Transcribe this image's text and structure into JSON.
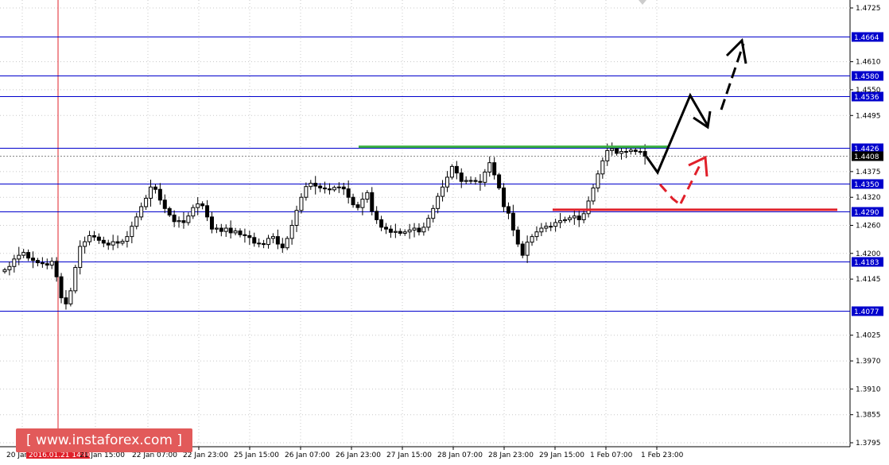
{
  "chart_data": {
    "type": "candlestick",
    "x_axis_labels": [
      "20 Jan 2016",
      "2016.01.21 14:00",
      "21 Jan 15:00",
      "22 Jan 07:00",
      "22 Jan 23:00",
      "25 Jan 15:00",
      "26 Jan 07:00",
      "26 Jan 23:00",
      "27 Jan 15:00",
      "28 Jan 07:00",
      "28 Jan 23:00",
      "29 Jan 15:00",
      "1 Feb 07:00",
      "1 Feb 23:00"
    ],
    "y_axis_ticks": [
      "1.4725",
      "1.4610",
      "1.4550",
      "1.4495",
      "1.4375",
      "1.4320",
      "1.4260",
      "1.4200",
      "1.4145",
      "1.4025",
      "1.3970",
      "1.3910",
      "1.3855",
      "1.3795"
    ],
    "ylim": [
      1.3795,
      1.4725
    ],
    "current_price": "1.4408",
    "levels": [
      {
        "price": 1.4664,
        "label": "1.4664"
      },
      {
        "price": 1.458,
        "label": "1.4580"
      },
      {
        "price": 1.4536,
        "label": "1.4536"
      },
      {
        "price": 1.4426,
        "label": "1.4426"
      },
      {
        "price": 1.435,
        "label": "1.4350"
      },
      {
        "price": 1.429,
        "label": "1.4290"
      },
      {
        "price": 1.4183,
        "label": "1.4183"
      },
      {
        "price": 1.4077,
        "label": "1.4077"
      }
    ],
    "resistance_line": {
      "price": 1.4428,
      "color": "#3cb043"
    },
    "support_line": {
      "price": 1.429,
      "color": "#e0202a"
    },
    "vertical_marker": {
      "label": "2016.01.21 14:00",
      "color": "#e0202a"
    },
    "close_prices": [
      1.4165,
      1.4172,
      1.4188,
      1.4196,
      1.4202,
      1.419,
      1.4185,
      1.418,
      1.4178,
      1.4175,
      1.4183,
      1.415,
      1.4105,
      1.4092,
      1.412,
      1.417,
      1.4215,
      1.4225,
      1.4238,
      1.4235,
      1.4228,
      1.4222,
      1.4218,
      1.4225,
      1.4222,
      1.4226,
      1.4236,
      1.4258,
      1.4278,
      1.43,
      1.4318,
      1.4342,
      1.4337,
      1.4314,
      1.4296,
      1.4282,
      1.4268,
      1.427,
      1.4266,
      1.428,
      1.4298,
      1.4306,
      1.4302,
      1.4278,
      1.4252,
      1.4254,
      1.4247,
      1.4254,
      1.4244,
      1.4248,
      1.424,
      1.4238,
      1.4234,
      1.4222,
      1.4221,
      1.4219,
      1.4232,
      1.4236,
      1.422,
      1.4212,
      1.4232,
      1.426,
      1.4292,
      1.432,
      1.4343,
      1.435,
      1.4344,
      1.434,
      1.4338,
      1.4336,
      1.4341,
      1.4342,
      1.4338,
      1.432,
      1.4304,
      1.4298,
      1.4316,
      1.433,
      1.429,
      1.4272,
      1.4256,
      1.4252,
      1.4245,
      1.4247,
      1.4243,
      1.4246,
      1.425,
      1.4254,
      1.4246,
      1.4256,
      1.4275,
      1.4296,
      1.4322,
      1.4342,
      1.4363,
      1.4386,
      1.4372,
      1.4354,
      1.4356,
      1.4356,
      1.4354,
      1.4352,
      1.4374,
      1.4394,
      1.4368,
      1.434,
      1.43,
      1.4286,
      1.425,
      1.422,
      1.4196,
      1.4224,
      1.4236,
      1.4246,
      1.4254,
      1.4258,
      1.4258,
      1.4266,
      1.427,
      1.4272,
      1.4276,
      1.428,
      1.4272,
      1.4285,
      1.4312,
      1.434,
      1.437,
      1.4398,
      1.442,
      1.4424,
      1.4414,
      1.4418,
      1.4418,
      1.4421,
      1.4418,
      1.4418,
      1.4408
    ]
  },
  "annotations": {
    "resistance_color": "#3cb043",
    "support_color": "#e0202a",
    "level_label_bg": "#0000cc",
    "forecast_primary": "black arrows up toward 1.4536 then 1.4664",
    "forecast_alternative": "red dashed arrow dip toward 1.4290"
  },
  "watermark": {
    "text": "[ www.instaforex.com ]"
  }
}
